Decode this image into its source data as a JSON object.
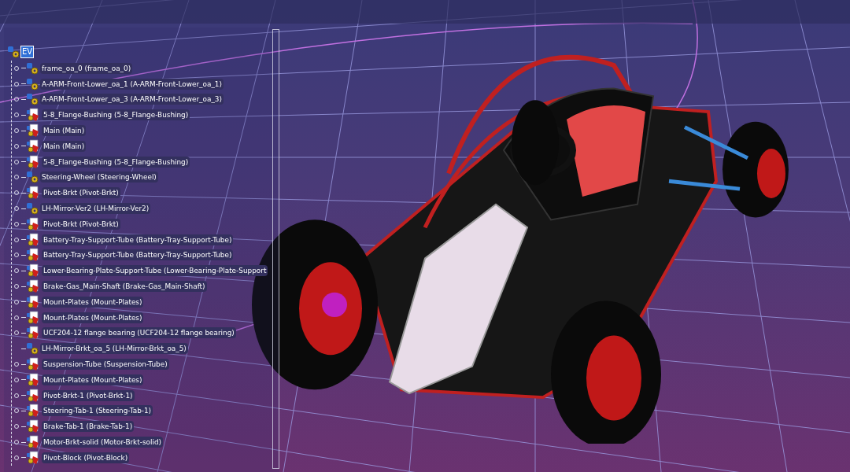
{
  "tree": {
    "label": "EV",
    "selected": true,
    "children": [
      {
        "label": "frame_oa_0 (frame_oa_0)",
        "kind": "product",
        "expandable": true
      },
      {
        "label": "A-ARM-Front-Lower_oa_1 (A-ARM-Front-Lower_oa_1)",
        "kind": "product",
        "expandable": true
      },
      {
        "label": "A-ARM-Front-Lower_oa_3 (A-ARM-Front-Lower_oa_3)",
        "kind": "product",
        "expandable": true
      },
      {
        "label": "5-8_Flange-Bushing (5-8_Flange-Bushing)",
        "kind": "part",
        "expandable": true
      },
      {
        "label": "Main (Main)",
        "kind": "part",
        "expandable": true
      },
      {
        "label": "Main (Main)",
        "kind": "part",
        "expandable": true
      },
      {
        "label": "5-8_Flange-Bushing (5-8_Flange-Bushing)",
        "kind": "part",
        "expandable": true
      },
      {
        "label": "Steering-Wheel (Steering-Wheel)",
        "kind": "product",
        "expandable": true
      },
      {
        "label": "Pivot-Brkt (Pivot-Brkt)",
        "kind": "part",
        "expandable": true
      },
      {
        "label": "LH-Mirror-Ver2 (LH-Mirror-Ver2)",
        "kind": "product",
        "expandable": true
      },
      {
        "label": "Pivot-Brkt (Pivot-Brkt)",
        "kind": "part",
        "expandable": true
      },
      {
        "label": "Battery-Tray-Support-Tube (Battery-Tray-Support-Tube)",
        "kind": "part",
        "expandable": true
      },
      {
        "label": "Battery-Tray-Support-Tube (Battery-Tray-Support-Tube)",
        "kind": "part",
        "expandable": true
      },
      {
        "label": "Lower-Bearing-Plate-Support-Tube (Lower-Bearing-Plate-Support",
        "kind": "part",
        "expandable": true
      },
      {
        "label": "Brake-Gas_Main-Shaft (Brake-Gas_Main-Shaft)",
        "kind": "part",
        "expandable": true
      },
      {
        "label": "Mount-Plates (Mount-Plates)",
        "kind": "part",
        "expandable": true
      },
      {
        "label": "Mount-Plates (Mount-Plates)",
        "kind": "part",
        "expandable": true
      },
      {
        "label": "UCF204-12 flange bearing (UCF204-12 flange bearing)",
        "kind": "part",
        "expandable": true
      },
      {
        "label": "LH-Mirror-Brkt_oa_5 (LH-Mirror-Brkt_oa_5)",
        "kind": "product",
        "expandable": false
      },
      {
        "label": "Suspension-Tube (Suspension-Tube)",
        "kind": "part",
        "expandable": true
      },
      {
        "label": "Mount-Plates (Mount-Plates)",
        "kind": "part",
        "expandable": true
      },
      {
        "label": "Pivot-Brkt-1 (Pivot-Brkt-1)",
        "kind": "part",
        "expandable": true
      },
      {
        "label": "Steering-Tab-1 (Steering-Tab-1)",
        "kind": "part",
        "expandable": true
      },
      {
        "label": "Brake-Tab-1 (Brake-Tab-1)",
        "kind": "part",
        "expandable": true
      },
      {
        "label": "Motor-Brkt-solid (Motor-Brkt-solid)",
        "kind": "part",
        "expandable": true
      },
      {
        "label": "Pivot-Block (Pivot-Block)",
        "kind": "part",
        "expandable": true
      }
    ]
  }
}
